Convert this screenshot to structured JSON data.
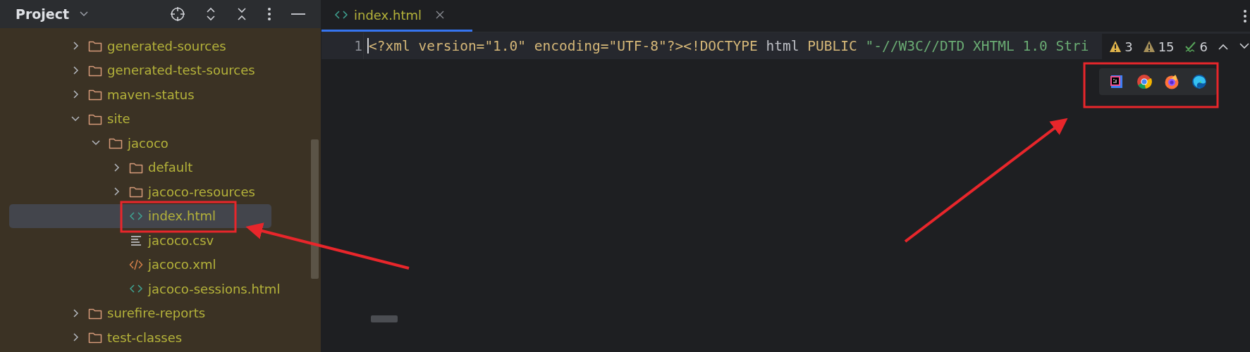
{
  "project_panel": {
    "title": "Project",
    "tree": [
      {
        "label": "generated-sources",
        "kind": "folder",
        "expanded": false
      },
      {
        "label": "generated-test-sources",
        "kind": "folder",
        "expanded": false
      },
      {
        "label": "maven-status",
        "kind": "folder",
        "expanded": false
      },
      {
        "label": "site",
        "kind": "folder",
        "expanded": true,
        "children": [
          {
            "label": "jacoco",
            "kind": "folder",
            "expanded": true,
            "children": [
              {
                "label": "default",
                "kind": "folder",
                "expanded": false
              },
              {
                "label": "jacoco-resources",
                "kind": "folder",
                "expanded": false
              },
              {
                "label": "index.html",
                "kind": "html",
                "selected": true
              },
              {
                "label": "jacoco.csv",
                "kind": "csv",
                "selected": false
              },
              {
                "label": "jacoco.xml",
                "kind": "xml",
                "selected": false
              },
              {
                "label": "jacoco-sessions.html",
                "kind": "html",
                "selected": false
              }
            ]
          }
        ]
      },
      {
        "label": "surefire-reports",
        "kind": "folder",
        "expanded": false
      },
      {
        "label": "test-classes",
        "kind": "folder",
        "expanded": false
      }
    ]
  },
  "editor": {
    "tabs": [
      {
        "label": "index.html",
        "selected": true
      }
    ],
    "lines": [
      {
        "number": "1",
        "tokens": [
          {
            "kind": "tag",
            "text": "<?xml version="
          },
          {
            "kind": "value",
            "text": "\"1.0\""
          },
          {
            "kind": "tag",
            "text": " encoding="
          },
          {
            "kind": "value",
            "text": "\"UTF-8\""
          },
          {
            "kind": "tag",
            "text": "?><!DOCTYPE "
          },
          {
            "kind": "name",
            "text": "html "
          },
          {
            "kind": "tag",
            "text": "PUBLIC "
          },
          {
            "kind": "string",
            "text": "\"-//W3C//DTD XHTML 1.0 Stri"
          }
        ]
      }
    ],
    "inspections": [
      {
        "kind": "warning",
        "count": "3"
      },
      {
        "kind": "weak-warning",
        "count": "15"
      },
      {
        "kind": "typo",
        "count": "6"
      }
    ],
    "browsers": [
      {
        "kind": "ide"
      },
      {
        "kind": "chrome"
      },
      {
        "kind": "firefox"
      },
      {
        "kind": "edge"
      }
    ]
  }
}
